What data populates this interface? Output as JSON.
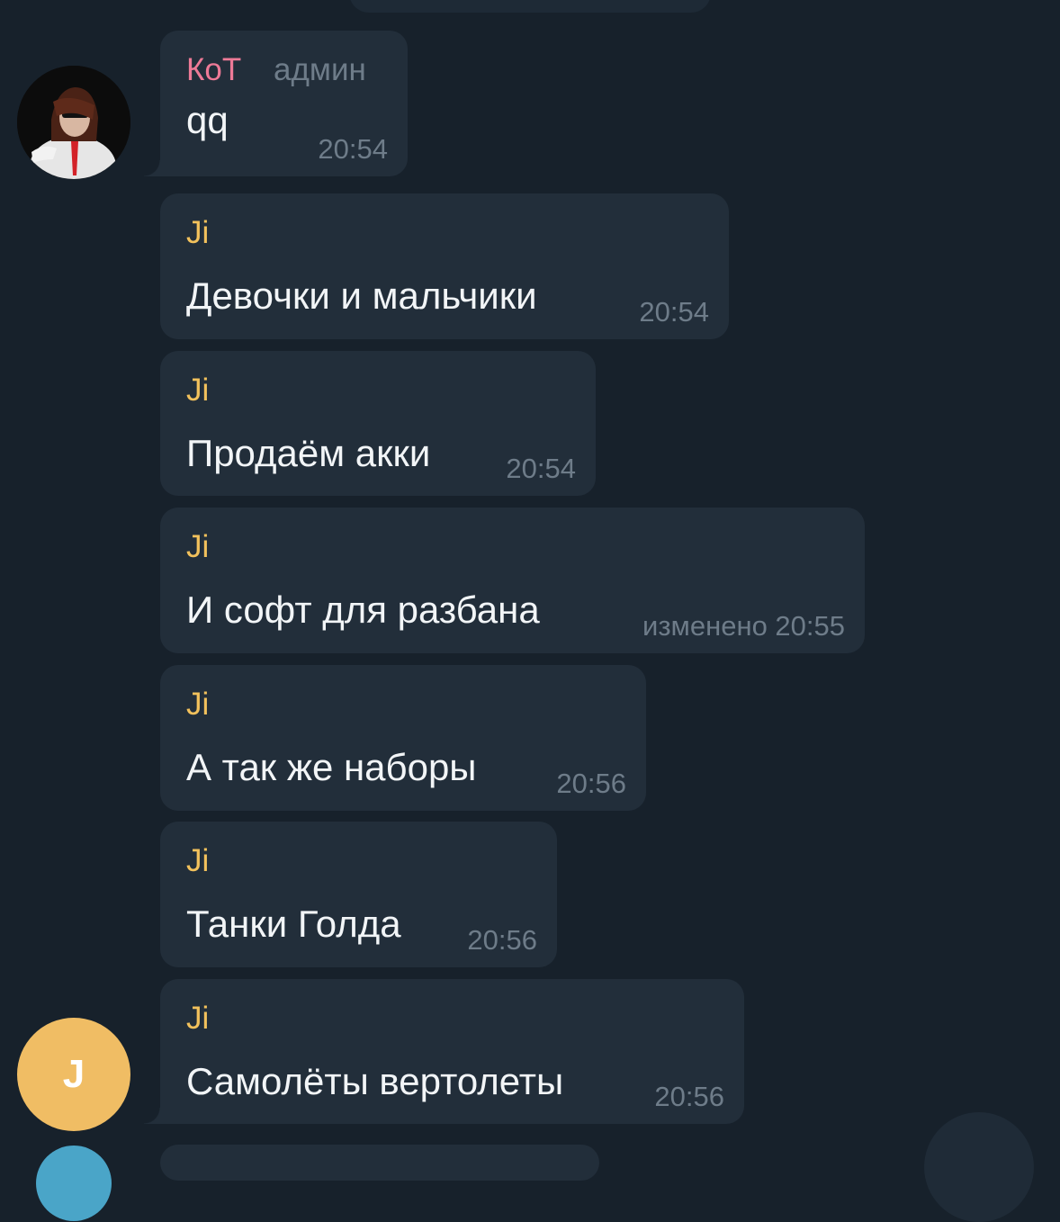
{
  "messages": [
    {
      "sender": "КоТ",
      "role": "админ",
      "text": "qq",
      "time": "20:54"
    },
    {
      "sender": "Ji",
      "text": "Девочки и мальчики",
      "time": "20:54"
    },
    {
      "sender": "Ji",
      "text": "Продаём акки",
      "time": "20:54"
    },
    {
      "sender": "Ji",
      "text": "И софт для разбана",
      "time": "изменено 20:55"
    },
    {
      "sender": "Ji",
      "text": "А так же наборы",
      "time": "20:56"
    },
    {
      "sender": "Ji",
      "text": "Танки Голда",
      "time": "20:56"
    },
    {
      "sender": "Ji",
      "text": "Самолёты вертолеты",
      "time": "20:56"
    }
  ],
  "avatars": {
    "kot": {
      "icon": "user-photo-avatar"
    },
    "ji": {
      "initial": "J",
      "color": "#f0bd64"
    }
  },
  "colors": {
    "background": "#17212b",
    "bubble": "#222e3a",
    "sender_ji": "#f2c15c",
    "sender_kot": "#ee7a97",
    "meta_text": "#6e7c89",
    "message_text": "#f2f5f7"
  }
}
